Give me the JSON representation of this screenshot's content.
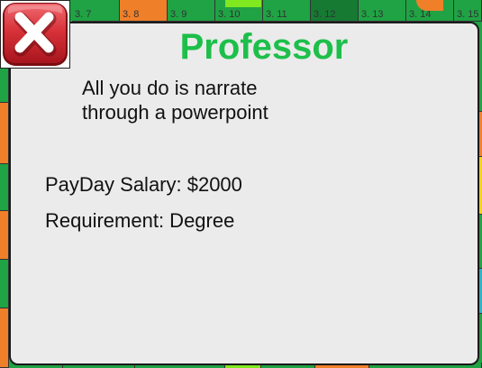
{
  "board": {
    "top_labels": [
      "3. 7",
      "3. 8",
      "3. 9",
      "3. 10",
      "3. 11",
      "3. 12",
      "3. 13",
      "3. 14",
      "3. 15"
    ],
    "colors": {
      "green": "#1fa344",
      "dark_green": "#167a33",
      "orange": "#f07f2a",
      "lime": "#7fe81f",
      "yellow": "#f2d21b",
      "teal": "#2bb3c7"
    }
  },
  "card": {
    "title": "Professor",
    "description_line1": "All you do is narrate",
    "description_line2": "through a powerpoint",
    "salary": "PayDay Salary: $2000",
    "requirement": "Requirement: Degree",
    "title_color": "#1dbf4a",
    "background_color": "#ebebeb"
  },
  "close_button": {
    "icon": "close-icon",
    "color": "#d8323a"
  }
}
